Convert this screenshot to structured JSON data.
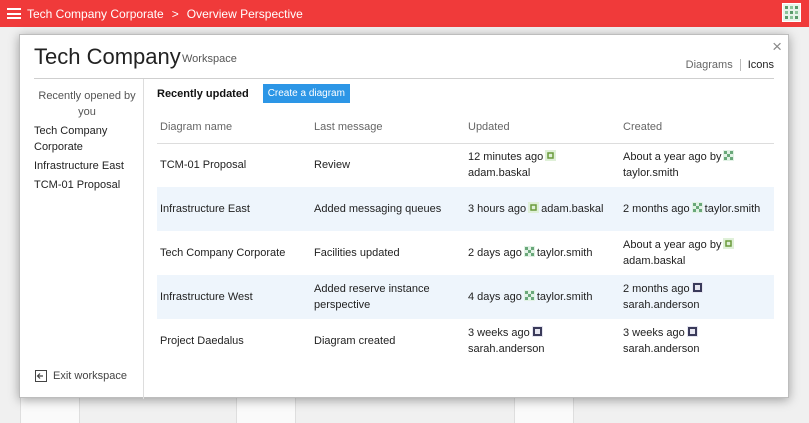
{
  "topbar": {
    "crumb1": "Tech Company Corporate",
    "sep": ">",
    "crumb2": "Overview Perspective"
  },
  "modal": {
    "title": "Tech Company",
    "subtitle": "Workspace",
    "close": "×",
    "view_diagrams": "Diagrams",
    "view_icons": "Icons"
  },
  "sidebar": {
    "recent_label": "Recently opened by you",
    "items": [
      "Tech Company Corporate",
      "Infrastructure East",
      "TCM-01 Proposal"
    ],
    "exit": "Exit workspace"
  },
  "main": {
    "heading": "Recently updated",
    "create": "Create a diagram",
    "columns": [
      "Diagram name",
      "Last message",
      "Updated",
      "Created"
    ],
    "rows": [
      {
        "name": "TCM-01 Proposal",
        "message": "Review",
        "updated_time": "12 minutes ago",
        "updated_user": "adam.baskal",
        "created_time": "About a year ago by",
        "created_user": "taylor.smith"
      },
      {
        "name": "Infrastructure East",
        "message": "Added messaging queues",
        "updated_time": "3 hours ago",
        "updated_user": "adam.baskal",
        "created_time": "2 months ago",
        "created_user": "taylor.smith"
      },
      {
        "name": "Tech Company Corporate",
        "message": "Facilities updated",
        "updated_time": "2 days ago",
        "updated_user": "taylor.smith",
        "created_time": "About a year ago by",
        "created_user": "adam.baskal"
      },
      {
        "name": "Infrastructure West",
        "message": "Added reserve instance perspective",
        "updated_time": "4 days ago",
        "updated_user": "taylor.smith",
        "created_time": "2 months ago",
        "created_user": "sarah.anderson"
      },
      {
        "name": "Project Daedalus",
        "message": "Diagram created",
        "updated_time": "3 weeks ago",
        "updated_user": "sarah.anderson",
        "created_time": "3 weeks ago",
        "created_user": "sarah.anderson"
      }
    ]
  },
  "colors": {
    "topbar": "#f03a3a",
    "accent": "#2c96e6",
    "row_alt": "#eef5fc"
  }
}
